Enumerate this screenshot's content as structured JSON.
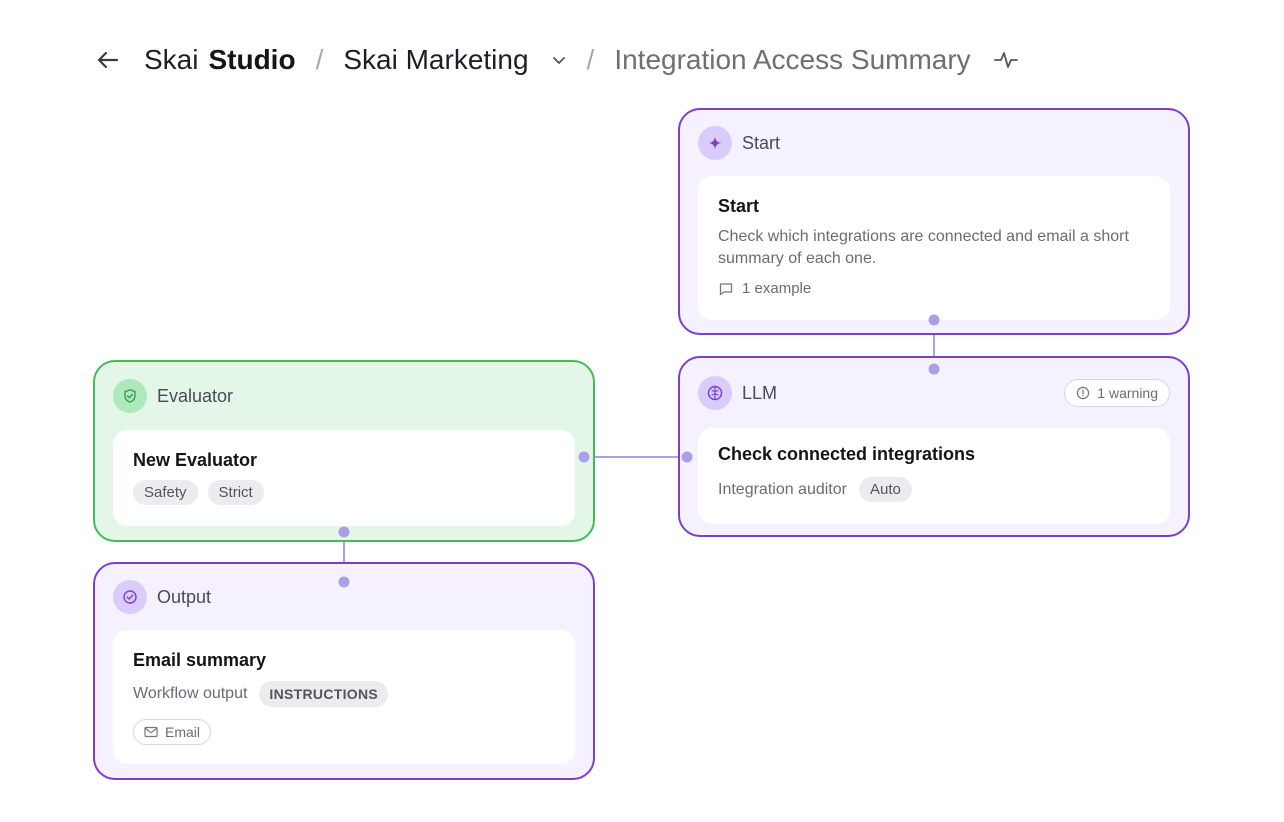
{
  "header": {
    "brand_part1": "Skai",
    "brand_part2": "Studio",
    "separator": "/",
    "project": "Skai Marketing",
    "page_title": "Integration Access Summary"
  },
  "icons": {
    "back": "arrow-left-icon",
    "project_dropdown": "chevron-down-icon",
    "activity": "pulse-icon",
    "start": "sparkle-icon",
    "llm": "brain-icon",
    "evaluator": "shield-check-icon",
    "output": "check-circle-icon",
    "example": "comment-icon",
    "warning": "info-circle-icon",
    "email": "mail-icon"
  },
  "colors": {
    "node_border_purple": "#7b3fd0",
    "node_bg_purple": "#f5f1ff",
    "node_border_green": "#3fbc58",
    "node_bg_green": "#e3f6e8",
    "connector": "#a9a0e8"
  },
  "nodes": {
    "start": {
      "type_label": "Start",
      "title": "Start",
      "description": "Check which integrations are connected and email a short summary of each one.",
      "examples": "1 example"
    },
    "llm": {
      "type_label": "LLM",
      "warning": "1 warning",
      "title": "Check connected integrations",
      "subtitle": "Integration auditor",
      "tag": "Auto"
    },
    "evaluator": {
      "type_label": "Evaluator",
      "title": "New Evaluator",
      "tags": [
        "Safety",
        "Strict"
      ]
    },
    "output": {
      "type_label": "Output",
      "title": "Email summary",
      "subtitle": "Workflow output",
      "tag": "INSTRUCTIONS",
      "channel": "Email"
    }
  }
}
